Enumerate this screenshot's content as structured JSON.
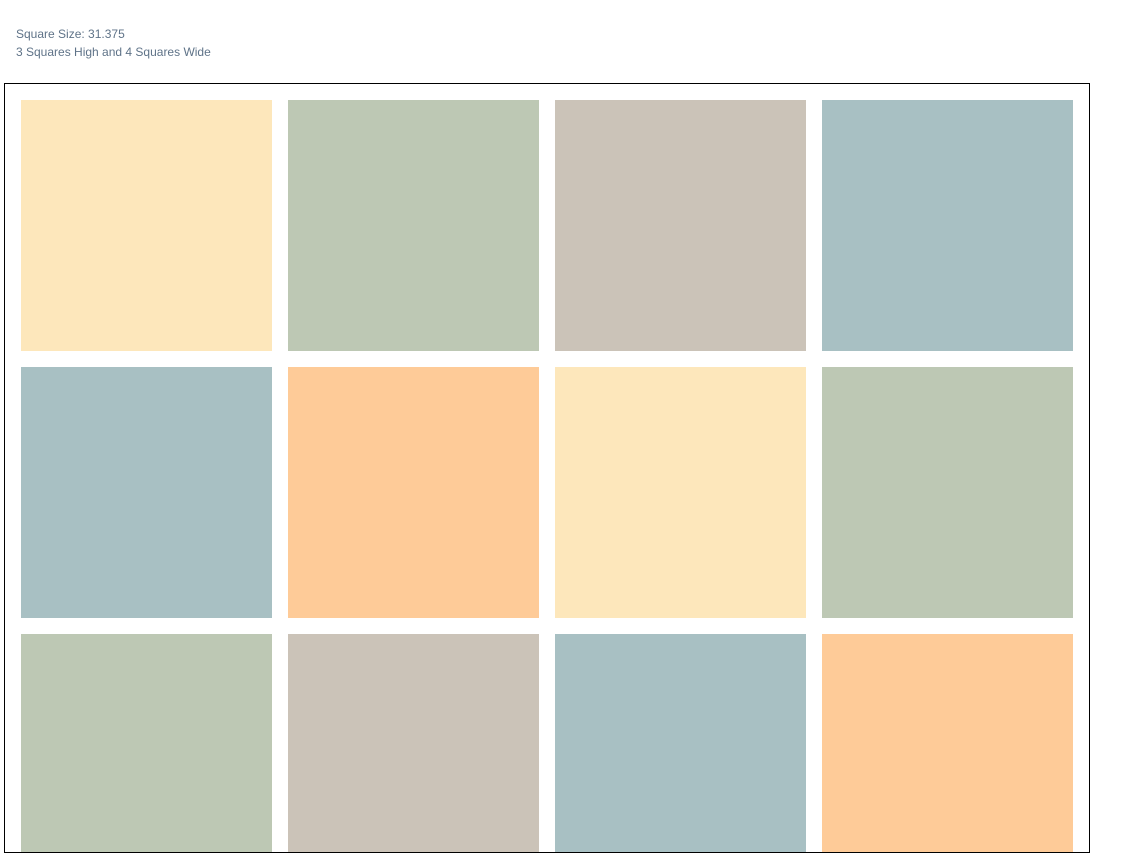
{
  "info": {
    "square_size_line": "Square Size: 31.375",
    "dimensions_line": "3 Squares High and 4 Squares Wide"
  },
  "palette": {
    "cream": "#fde7bb",
    "sage": "#bdc8b4",
    "taupe": "#cbc3b8",
    "teal_gray": "#a8c0c3",
    "peach": "#fecb98"
  },
  "grid": {
    "rows": 3,
    "cols": 4,
    "colors": [
      [
        "cream",
        "sage",
        "taupe",
        "teal_gray"
      ],
      [
        "teal_gray",
        "peach",
        "cream",
        "sage"
      ],
      [
        "sage",
        "taupe",
        "teal_gray",
        "peach"
      ]
    ]
  }
}
